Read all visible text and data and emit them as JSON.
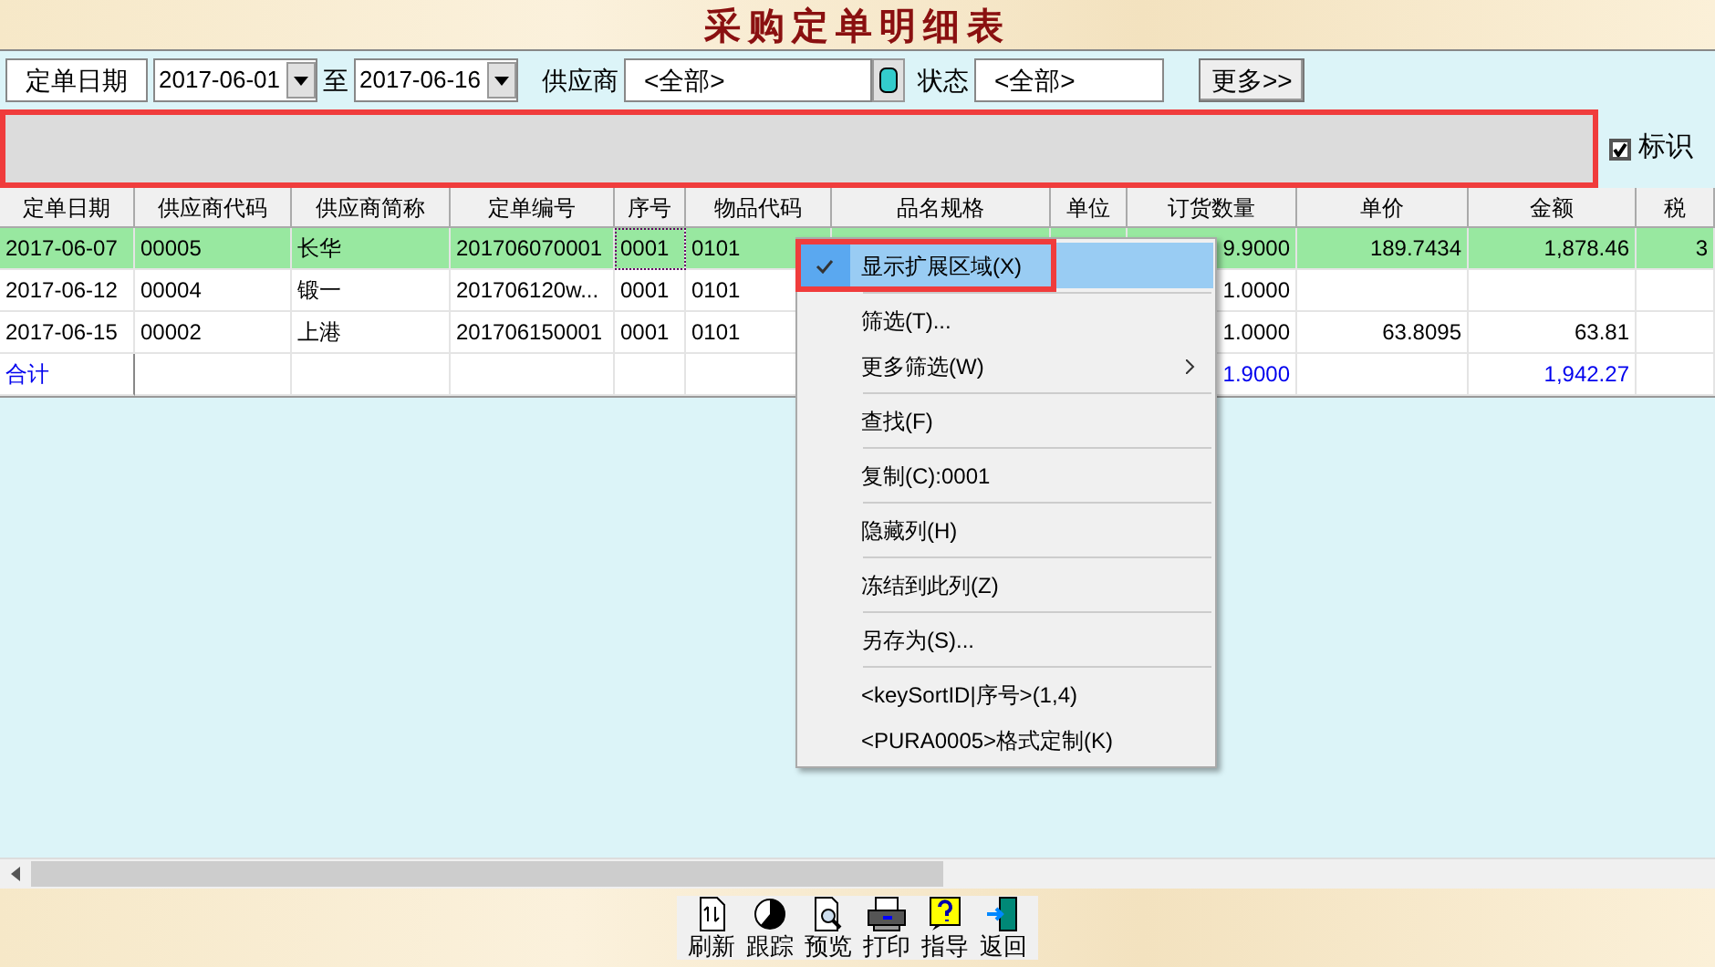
{
  "title": "采购定单明细表",
  "filters": {
    "date_label": "定单日期",
    "date_from": "2017-06-01",
    "to_label": "至",
    "date_to": "2017-06-16",
    "supplier_label": "供应商",
    "supplier_value": "<全部>",
    "status_label": "状态",
    "status_value": "<全部>",
    "more_button": "更多>>"
  },
  "extension_area": {
    "checkbox_label": "标识",
    "checked": true
  },
  "table": {
    "columns": [
      "定单日期",
      "供应商代码",
      "供应商简称",
      "定单编号",
      "序号",
      "物品代码",
      "品名规格",
      "单位",
      "订货数量",
      "单价",
      "金额",
      "税"
    ],
    "rows": [
      {
        "selected": true,
        "cells": [
          "2017-06-07",
          "00005",
          "长华",
          "201706070001",
          "0001",
          "0101",
          "",
          "",
          "9.9000",
          "189.7434",
          "1,878.46",
          "3"
        ]
      },
      {
        "selected": false,
        "cells": [
          "2017-06-12",
          "00004",
          "锻一",
          "201706120w...",
          "0001",
          "0101",
          "",
          "",
          "1.0000",
          "",
          "",
          ""
        ]
      },
      {
        "selected": false,
        "cells": [
          "2017-06-15",
          "00002",
          "上港",
          "201706150001",
          "0001",
          "0101",
          "",
          "",
          "1.0000",
          "63.8095",
          "63.81",
          ""
        ]
      }
    ],
    "total": {
      "cells": [
        "合计",
        "",
        "",
        "",
        "",
        "",
        "",
        "",
        "1.9000",
        "",
        "1,942.27",
        ""
      ]
    }
  },
  "context_menu": [
    {
      "label": "显示扩展区域(X)",
      "checked": true,
      "selected": true,
      "submenu": false,
      "divider_after": true
    },
    {
      "label": "筛选(T)...",
      "checked": false,
      "selected": false,
      "submenu": false,
      "divider_after": false
    },
    {
      "label": "更多筛选(W)",
      "checked": false,
      "selected": false,
      "submenu": true,
      "divider_after": true
    },
    {
      "label": "查找(F)",
      "checked": false,
      "selected": false,
      "submenu": false,
      "divider_after": true
    },
    {
      "label": "复制(C):0001",
      "checked": false,
      "selected": false,
      "submenu": false,
      "divider_after": true
    },
    {
      "label": "隐藏列(H)",
      "checked": false,
      "selected": false,
      "submenu": false,
      "divider_after": true
    },
    {
      "label": "冻结到此列(Z)",
      "checked": false,
      "selected": false,
      "submenu": false,
      "divider_after": true
    },
    {
      "label": "另存为(S)...",
      "checked": false,
      "selected": false,
      "submenu": false,
      "divider_after": true
    },
    {
      "label": "<keySortID|序号>(1,4)",
      "checked": false,
      "selected": false,
      "submenu": false,
      "divider_after": false
    },
    {
      "label": "<PURA0005>格式定制(K)",
      "checked": false,
      "selected": false,
      "submenu": false,
      "divider_after": false
    }
  ],
  "toolbar": [
    {
      "kind": "refresh",
      "label": "刷新"
    },
    {
      "kind": "track",
      "label": "跟踪"
    },
    {
      "kind": "preview",
      "label": "预览"
    },
    {
      "kind": "print",
      "label": "打印"
    },
    {
      "kind": "help",
      "label": "指导"
    },
    {
      "kind": "back",
      "label": "返回"
    }
  ]
}
